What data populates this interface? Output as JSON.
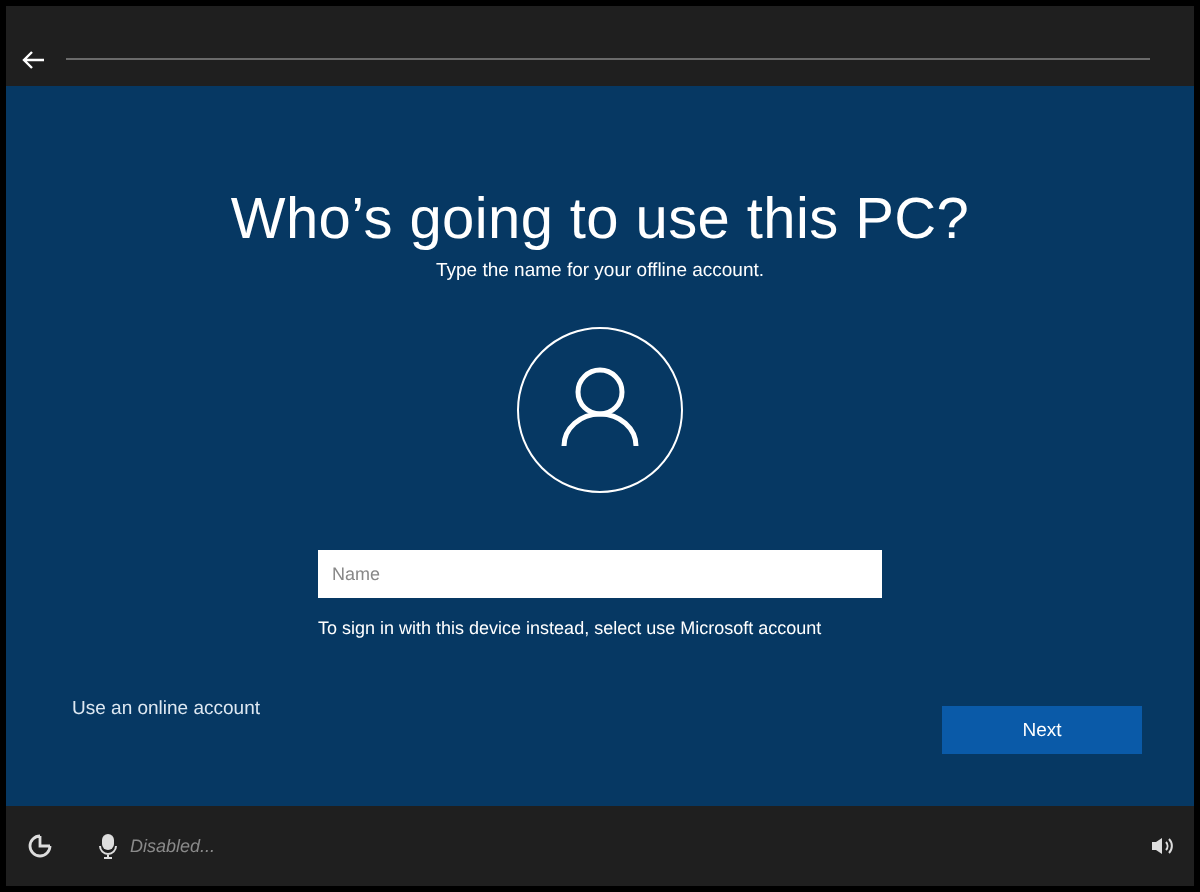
{
  "title": "Who’s going to use this PC?",
  "subtitle": "Type the name for your offline account.",
  "name_field": {
    "placeholder": "Name"
  },
  "hint": "To sign in with this device instead, select use Microsoft account",
  "online_link": "Use an online account",
  "next_button": "Next",
  "status_bar": {
    "mic_status": "Disabled..."
  }
}
